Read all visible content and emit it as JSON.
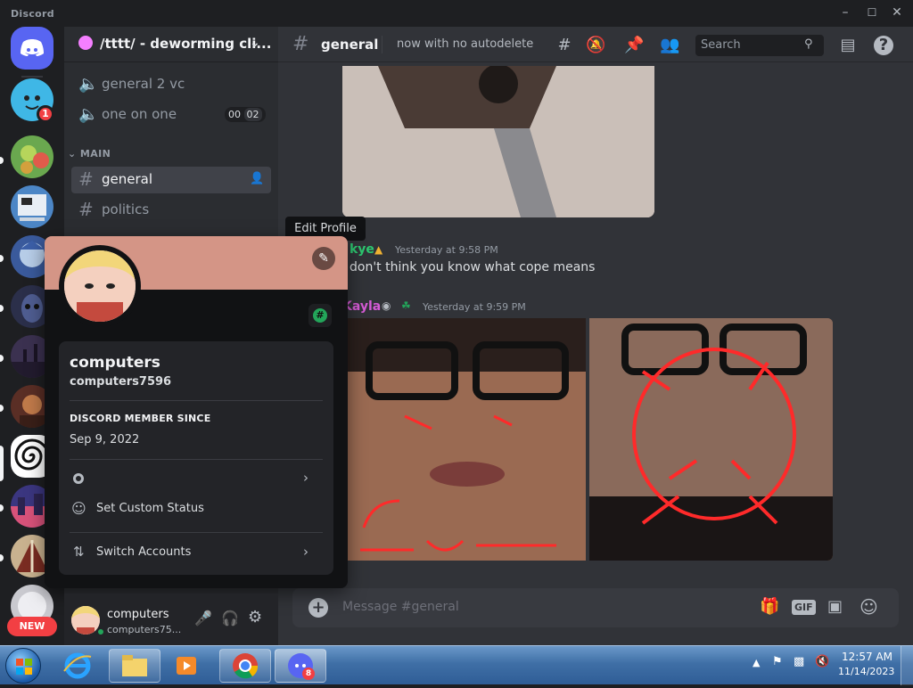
{
  "window": {
    "title": "Discord"
  },
  "server": {
    "name": "/tttt/ - deworming cli..."
  },
  "rail": {
    "badge_1": "1",
    "new_label": "NEW"
  },
  "channels": {
    "items": [
      {
        "label": "general 2 vc",
        "kind": "voice"
      },
      {
        "label": "one on one",
        "kind": "voice",
        "c1": "00",
        "c2": "02"
      }
    ],
    "category": "MAIN",
    "general": "general",
    "politics": "politics"
  },
  "chat": {
    "channel": "general",
    "topic": "now with no autodelete",
    "search_placeholder": "Search",
    "messages": [
      {
        "author": "kye",
        "author_color": "#2dc770",
        "time": "Yesterday at 9:58 PM",
        "text": "don't think you know what cope means"
      },
      {
        "author": "Kayla",
        "author_color": "#d65bd6",
        "time": "Yesterday at 9:59 PM",
        "text": ""
      }
    ],
    "composer_placeholder": "Message #general",
    "gif_label": "GIF"
  },
  "tooltip": {
    "text": "Edit Profile"
  },
  "profile": {
    "display_name": "computers",
    "username": "computers7596",
    "member_since_label": "DISCORD MEMBER SINCE",
    "member_since": "Sep 9, 2022",
    "custom_status": "Set Custom Status",
    "switch_accounts": "Switch Accounts"
  },
  "user": {
    "name": "computers",
    "tag": "computers75..."
  },
  "taskbar": {
    "time": "12:57 AM",
    "date": "11/14/2023",
    "discord_badge": "8"
  },
  "colors": {
    "banner": "#d49586",
    "accent": "#5865f2",
    "online": "#23a55a",
    "danger": "#f23f43"
  }
}
